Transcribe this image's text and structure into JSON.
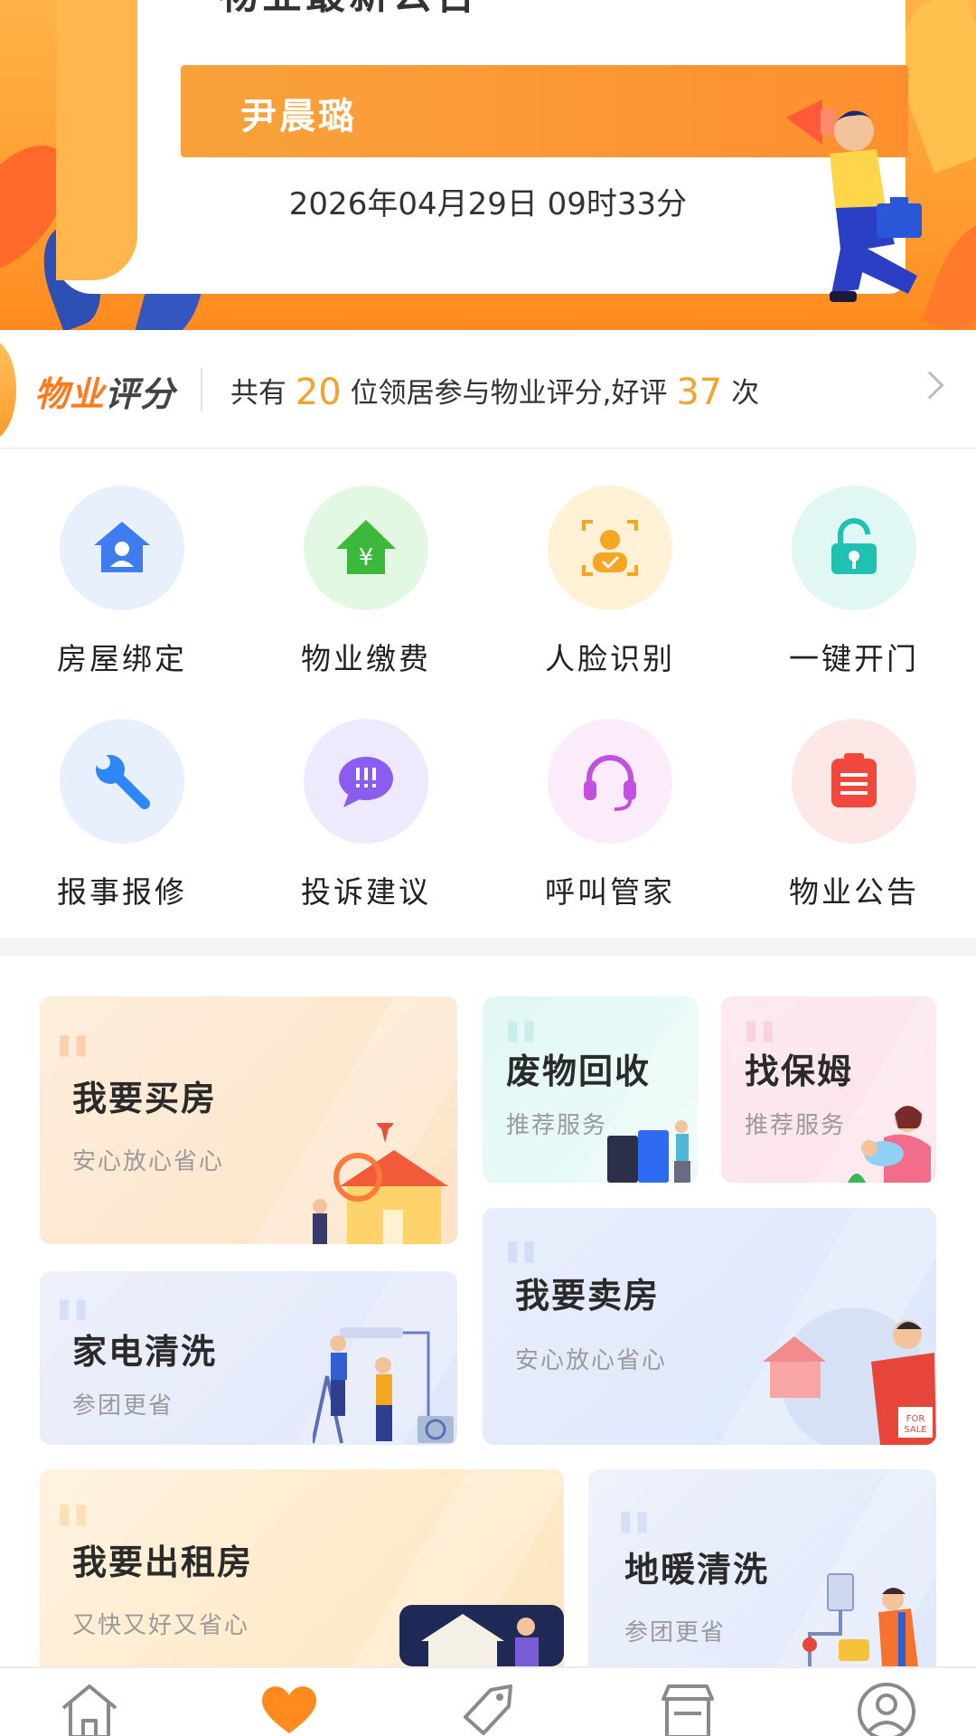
{
  "banner": {
    "title": "物业最新公告",
    "name": "尹晨璐",
    "datetime": "2026年04月29日 09时33分"
  },
  "rating": {
    "logo_part1": "物业",
    "logo_part2": "评分",
    "prefix": "共有",
    "residents": "20",
    "middle": "位领居参与物业评分,好评",
    "good_reviews": "37",
    "suffix": "次"
  },
  "services": [
    {
      "label": "房屋绑定",
      "icon": "house-bind-icon"
    },
    {
      "label": "物业缴费",
      "icon": "payment-icon"
    },
    {
      "label": "人脸识别",
      "icon": "face-recognition-icon"
    },
    {
      "label": "一键开门",
      "icon": "unlock-icon"
    },
    {
      "label": "报事报修",
      "icon": "wrench-icon"
    },
    {
      "label": "投诉建议",
      "icon": "complaint-chat-icon"
    },
    {
      "label": "呼叫管家",
      "icon": "headset-icon"
    },
    {
      "label": "物业公告",
      "icon": "notice-icon"
    }
  ],
  "cards": {
    "buy_house": {
      "title": "我要买房",
      "subtitle": "安心放心省心"
    },
    "waste": {
      "title": "废物回收",
      "subtitle": "推荐服务"
    },
    "nanny": {
      "title": "找保姆",
      "subtitle": "推荐服务"
    },
    "appliance": {
      "title": "家电清洗",
      "subtitle": "参团更省"
    },
    "sell_house": {
      "title": "我要卖房",
      "subtitle": "安心放心省心"
    },
    "rent_house": {
      "title": "我要出租房",
      "subtitle": "又快又好又省心"
    },
    "floor_heating": {
      "title": "地暖清洗",
      "subtitle": "参团更省"
    }
  },
  "tabbar": {
    "items": [
      {
        "icon": "home-icon"
      },
      {
        "icon": "heart-icon",
        "active": true
      },
      {
        "icon": "tag-icon"
      },
      {
        "icon": "store-icon"
      },
      {
        "icon": "profile-icon"
      }
    ],
    "active_color": "#ff8a1f",
    "inactive_color": "#8a8a8a"
  },
  "colors": {
    "accent": "#ff8f2e",
    "highlight_number": "#f5a22d"
  }
}
